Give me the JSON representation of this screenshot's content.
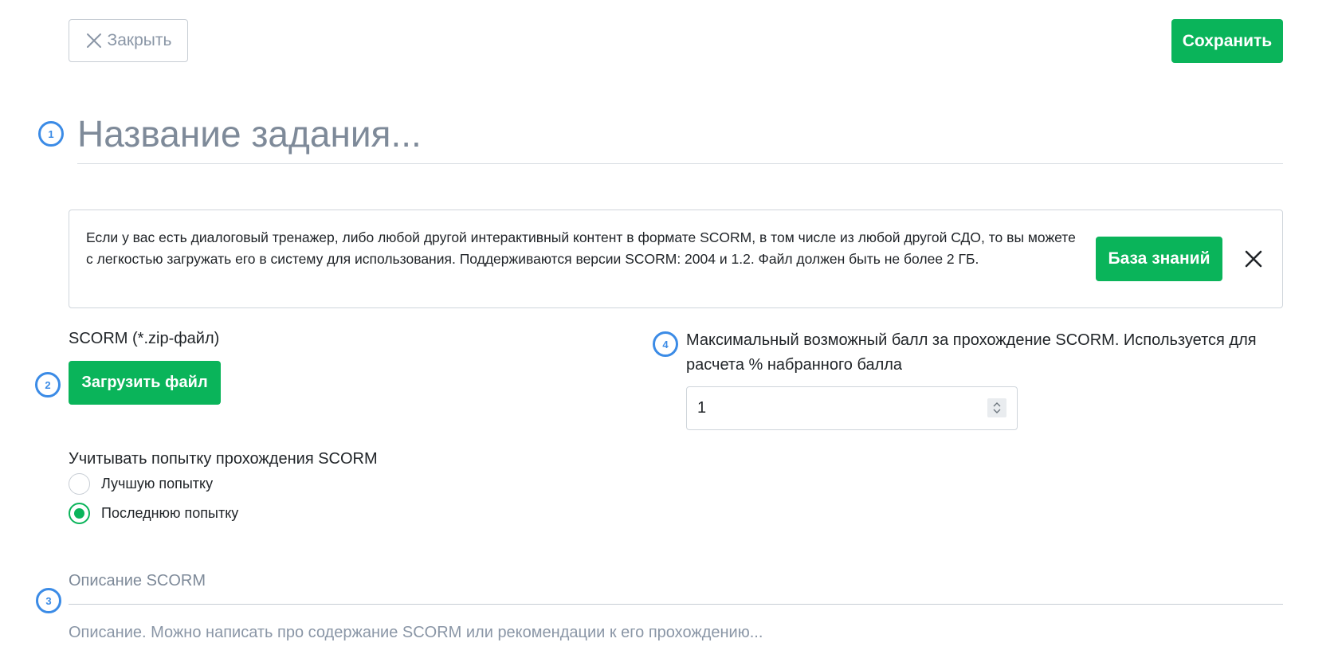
{
  "toolbar": {
    "close_label": "Закрыть",
    "save_label": "Сохранить"
  },
  "markers": [
    "1",
    "2",
    "3",
    "4"
  ],
  "task": {
    "title_placeholder": "Название задания..."
  },
  "info": {
    "text": "Если у вас есть диалоговый тренажер, либо любой другой интерактивный контент в формате SCORM, в том числе из любой другой СДО, то вы можете с легкостью загружать его в систему для использования. Поддерживаются версии SCORM: 2004 и 1.2. Файл должен быть не более 2 ГБ.",
    "knowledge_base_label": "База знаний"
  },
  "scorm_file": {
    "label": "SCORM (*.zip-файл)",
    "upload_label": "Загрузить файл"
  },
  "max_score": {
    "label": "Максимальный возможный балл за прохождение SCORM. Используется для расчета % набранного балла",
    "value": "1"
  },
  "attempt": {
    "title": "Учитывать попытку прохождения SCORM",
    "options": [
      {
        "label": "Лучшую попытку",
        "checked": false
      },
      {
        "label": "Последнюю попытку",
        "checked": true
      }
    ]
  },
  "description": {
    "label": "Описание SCORM",
    "placeholder": "Описание. Можно написать про содержание SCORM или рекомендации к его прохождению..."
  },
  "colors": {
    "accent": "#0ab45a",
    "marker": "#3b8be6",
    "muted_text": "#7e8a99"
  }
}
